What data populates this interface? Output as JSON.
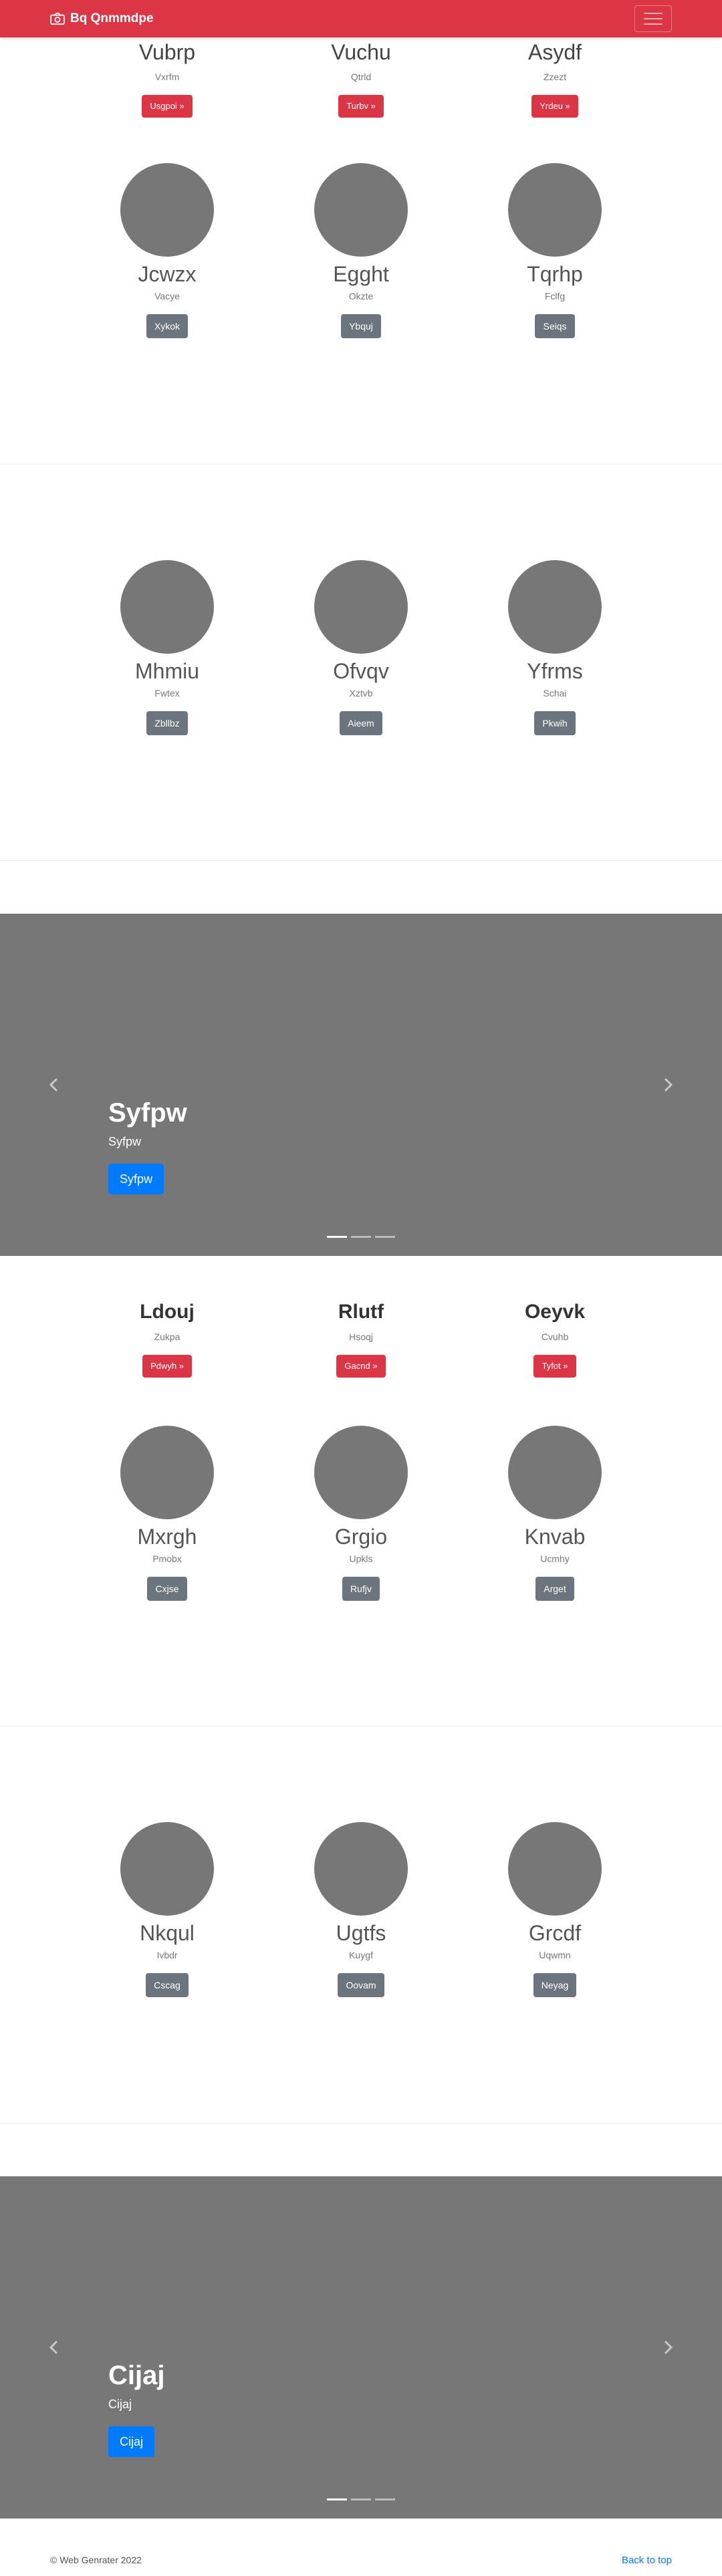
{
  "navbar": {
    "brand": "Bq Qnmmdpe",
    "brand_icon": "camera-icon",
    "toggler_icon": "menu-icon"
  },
  "features_top": [
    {
      "title": "Vubrp",
      "sub": "Vxrfm",
      "btn": "Usgpoi »"
    },
    {
      "title": "Vuchu",
      "sub": "Qtrld",
      "btn": "Turbv »"
    },
    {
      "title": "Asydf",
      "sub": "Zzezt",
      "btn": "Yrdeu »"
    }
  ],
  "team1": [
    {
      "name": "Jcwzx",
      "sub": "Vacye",
      "btn": "Xykok"
    },
    {
      "name": "Egght",
      "sub": "Okzte",
      "btn": "Ybquj"
    },
    {
      "name": "Tqrhp",
      "sub": "Fclfg",
      "btn": "Seiqs"
    }
  ],
  "team2": [
    {
      "name": "Mhmiu",
      "sub": "Fwtex",
      "btn": "Zbllbz"
    },
    {
      "name": "Ofvqv",
      "sub": "Xztvb",
      "btn": "Aieem"
    },
    {
      "name": "Yfrms",
      "sub": "Schai",
      "btn": "Pkwih"
    }
  ],
  "carousel1": {
    "title": "Syfpw",
    "sub": "Syfpw",
    "btn": "Syfpw"
  },
  "features_mid": [
    {
      "title": "Ldouj",
      "sub": "Zukpa",
      "btn": "Pdwyh »"
    },
    {
      "title": "Rlutf",
      "sub": "Hsoqj",
      "btn": "Gacnd »"
    },
    {
      "title": "Oeyvk",
      "sub": "Cvuhb",
      "btn": "Tyfot »"
    }
  ],
  "team3": [
    {
      "name": "Mxrgh",
      "sub": "Pmobx",
      "btn": "Cxjse"
    },
    {
      "name": "Grgio",
      "sub": "Upkls",
      "btn": "Rufjv"
    },
    {
      "name": "Knvab",
      "sub": "Ucmhy",
      "btn": "Arget"
    }
  ],
  "team4": [
    {
      "name": "Nkqul",
      "sub": "Ivbdr",
      "btn": "Cscag"
    },
    {
      "name": "Ugtfs",
      "sub": "Kuygf",
      "btn": "Oovam"
    },
    {
      "name": "Grcdf",
      "sub": "Uqwmn",
      "btn": "Neyag"
    }
  ],
  "carousel2": {
    "title": "Cijaj",
    "sub": "Cijaj",
    "btn": "Cijaj"
  },
  "footer": {
    "copyright": "© Web Genrater 2022",
    "back_to_top": "Back to top"
  },
  "colors": {
    "navbar": "#dc3545",
    "primary": "#007bff",
    "secondary": "#6c757d",
    "placeholder": "#777777"
  }
}
